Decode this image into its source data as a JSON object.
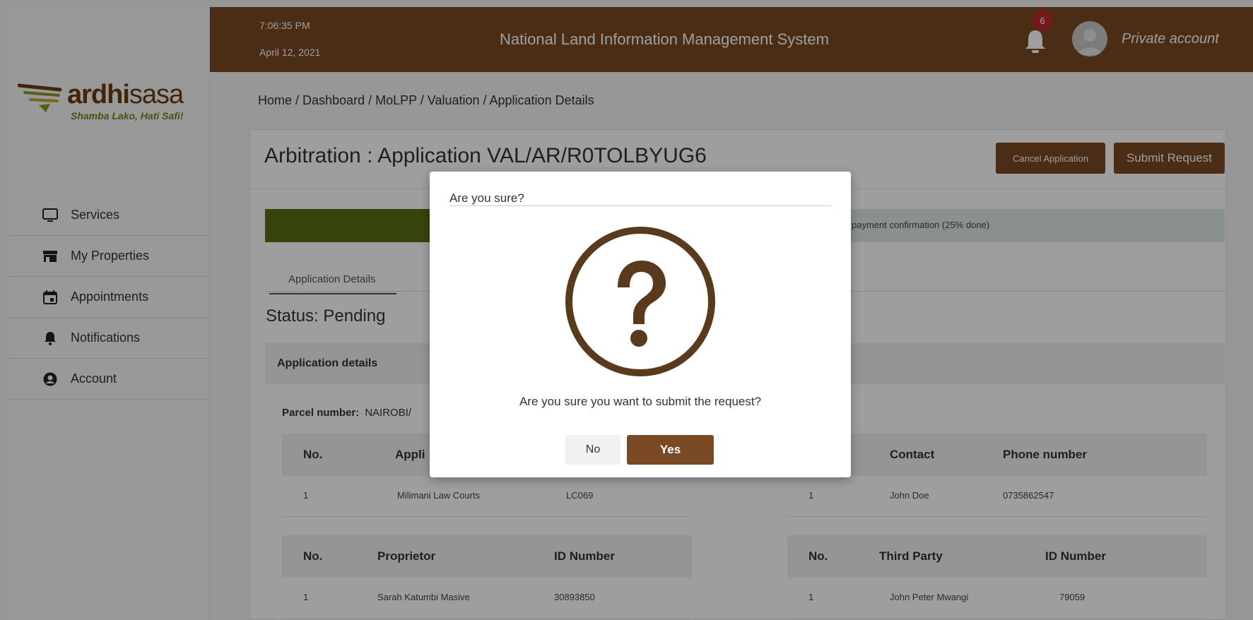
{
  "header": {
    "time": "7:06:35 PM",
    "date": "April 12, 2021",
    "title": "National Land Information Management System",
    "notification_count": "6",
    "account_label": "Private account"
  },
  "logo": {
    "word_bold": "ardhi",
    "word_thin": "sasa",
    "tagline": "Shamba Lako, Hati Safi!"
  },
  "sidebar": {
    "items": [
      {
        "label": "Services",
        "icon": "monitor-icon"
      },
      {
        "label": "My Properties",
        "icon": "store-icon"
      },
      {
        "label": "Appointments",
        "icon": "calendar-icon"
      },
      {
        "label": "Notifications",
        "icon": "bell-icon"
      },
      {
        "label": "Account",
        "icon": "user-circle-icon"
      }
    ]
  },
  "breadcrumb": "Home / Dashboard / MoLPP / Valuation / Application Details",
  "page": {
    "title": "Arbitration : Application VAL/AR/R0TOLBYUG6",
    "cancel_label": "Cancel Application",
    "submit_label": "Submit Request",
    "progress_text": "payment confirmation (25% done)",
    "progress_fraction": 0.25,
    "tab_label": "Application Details",
    "status": "Status: Pending",
    "section_label": "Application details",
    "parcel_label": "Parcel number:",
    "parcel_value": "NAIROBI/"
  },
  "tables": {
    "applicant": {
      "headers": [
        "No.",
        "Appli"
      ],
      "row": [
        "1",
        "Milimani Law Courts",
        "LC069"
      ]
    },
    "contact": {
      "headers": [
        "Contact",
        "Phone number"
      ],
      "row": [
        "1",
        "John Doe",
        "0735862547"
      ]
    },
    "proprietor": {
      "headers": [
        "No.",
        "Proprietor",
        "ID Number"
      ],
      "row": [
        "1",
        "Sarah Katumbi Masive",
        "30893850"
      ]
    },
    "third_party": {
      "headers": [
        "No.",
        "Third Party",
        "ID Number"
      ],
      "row": [
        "1",
        "John Peter Mwangi",
        "79059"
      ]
    }
  },
  "modal": {
    "title": "Are you sure?",
    "message": "Are you sure you want to submit the request?",
    "no_label": "No",
    "yes_label": "Yes"
  },
  "colors": {
    "brand": "#7a4a24",
    "progress": "#5a6e12",
    "badge": "#b72d2d"
  }
}
